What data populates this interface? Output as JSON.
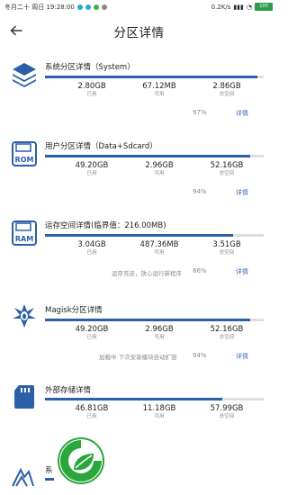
{
  "status_bar": {
    "date_time": "冬月二十 周日 19:28:00",
    "net_speed": "0.2K/s",
    "battery": "100"
  },
  "header": {
    "title": "分区详情"
  },
  "labels": {
    "used": "已用",
    "free": "可用",
    "total": "总空间",
    "detail": "详情"
  },
  "sections": [
    {
      "title": "系统分区详情（System）",
      "icon": "layers-icon",
      "used": "2.80GB",
      "free": "67.12MB",
      "total": "2.86GB",
      "percent": "97%",
      "fill": 0.97,
      "note": ""
    },
    {
      "title": "用户分区详情（Data+Sdcard）",
      "icon": "rom-icon",
      "used": "49.20GB",
      "free": "2.96GB",
      "total": "52.16GB",
      "percent": "94%",
      "fill": 0.94,
      "note": ""
    },
    {
      "title": "运存空间详情(临界值：216.00MB)",
      "icon": "ram-icon",
      "used": "3.04GB",
      "free": "487.36MB",
      "total": "3.51GB",
      "percent": "86%",
      "fill": 0.86,
      "note": "运存充足，放心运行新程序"
    },
    {
      "title": "Magisk分区详情",
      "icon": "magisk-icon",
      "used": "49.20GB",
      "free": "2.96GB",
      "total": "52.16GB",
      "percent": "94%",
      "fill": 0.94,
      "note": "加载中    下次安装模块自动扩容"
    },
    {
      "title": "外部存储详情",
      "icon": "sd-card-icon",
      "used": "46.81GB",
      "free": "11.18GB",
      "total": "57.99GB",
      "percent": "",
      "fill": 0.81,
      "note": ""
    }
  ],
  "partial_section": {
    "title": "系",
    "icon": "partial-icon"
  },
  "colors": {
    "accent": "#2b5fa8",
    "link": "#3a67b0",
    "fab_green": "#2aa63b"
  }
}
